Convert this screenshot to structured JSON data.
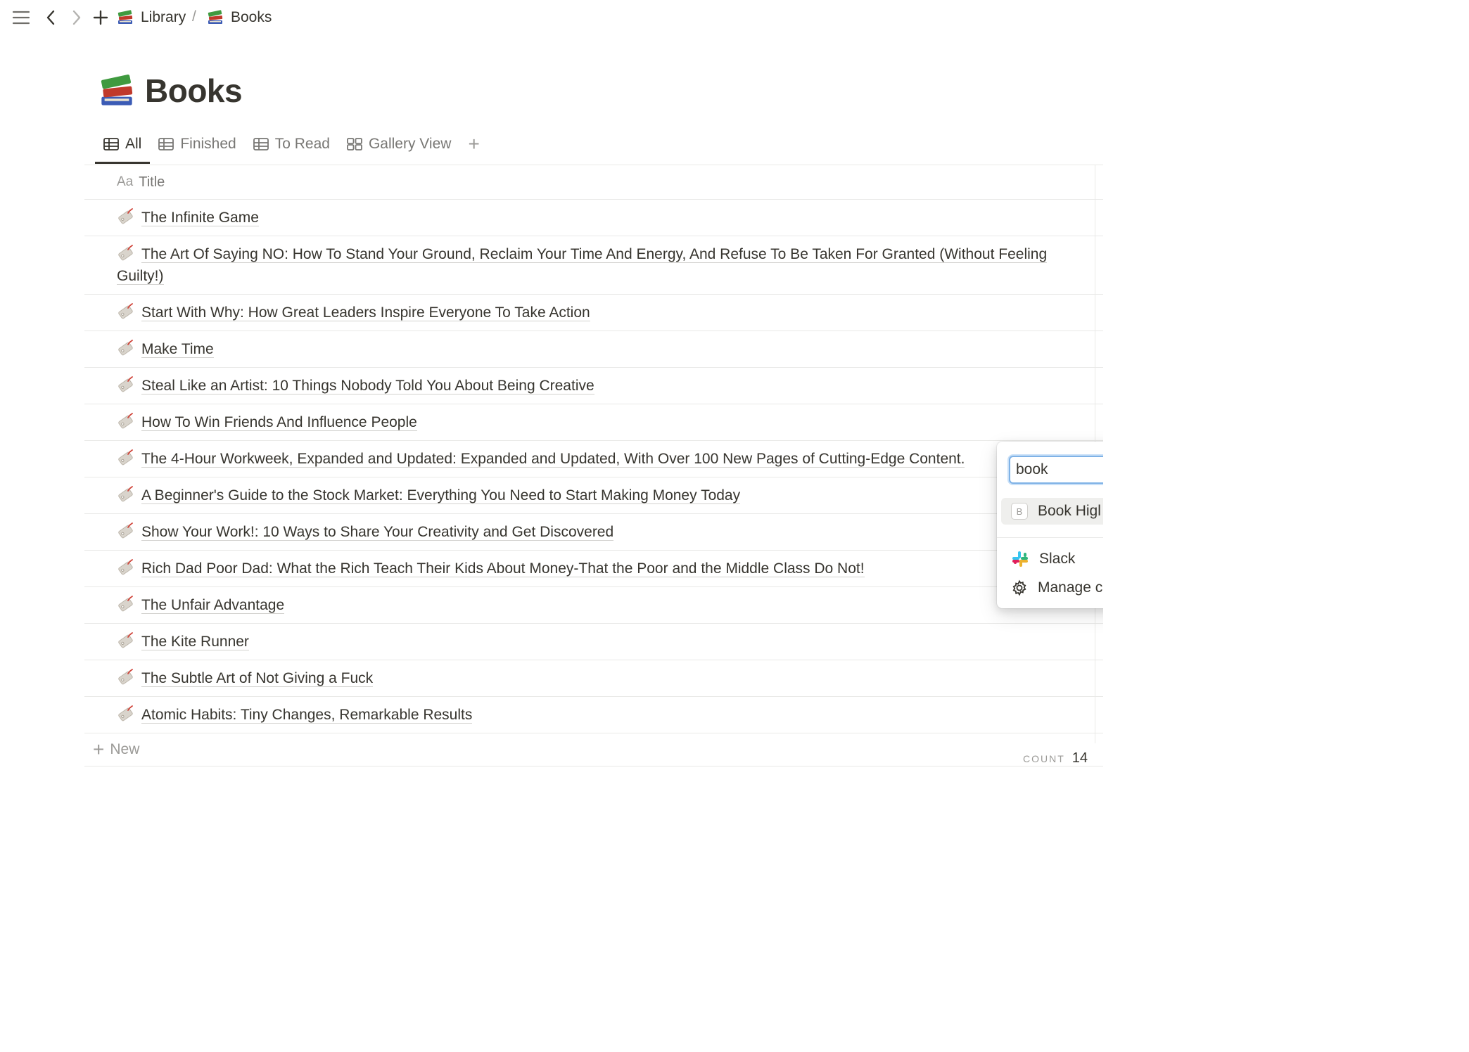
{
  "topbar": {
    "breadcrumbs": [
      {
        "label": "Library",
        "icon": "books-emoji"
      },
      {
        "label": "Books",
        "icon": "books-emoji"
      }
    ],
    "separator": "/"
  },
  "page": {
    "title": "Books",
    "icon": "books-emoji"
  },
  "tabs": [
    {
      "label": "All",
      "icon": "table-icon",
      "active": true
    },
    {
      "label": "Finished",
      "icon": "table-icon"
    },
    {
      "label": "To Read",
      "icon": "table-icon"
    },
    {
      "label": "Gallery View",
      "icon": "gallery-icon"
    }
  ],
  "table": {
    "header": {
      "icon_text": "Aa",
      "label": "Title"
    },
    "rows": [
      "The Infinite Game",
      "The Art Of Saying NO: How To Stand Your Ground, Reclaim Your Time And Energy, And Refuse To Be Taken For Granted (Without Feeling Guilty!)",
      "Start With Why: How Great Leaders Inspire Everyone To Take Action",
      "Make Time",
      "Steal Like an Artist: 10 Things Nobody Told You About Being Creative",
      "How To Win Friends And Influence People",
      "The 4-Hour Workweek, Expanded and Updated: Expanded and Updated, With Over 100 New Pages of Cutting-Edge Content.",
      "A Beginner's Guide to the Stock Market: Everything You Need to Start Making Money Today",
      "Show Your Work!: 10 Ways to Share Your Creativity and Get Discovered",
      "Rich Dad Poor Dad: What the Rich Teach Their Kids About Money-That the Poor and the Middle Class Do Not!",
      "The Unfair Advantage",
      "The Kite Runner",
      "The Subtle Art of Not Giving a Fuck",
      "Atomic Habits: Tiny Changes, Remarkable Results"
    ],
    "new_label": "New",
    "count_label": "COUNT",
    "count_value": "14"
  },
  "popup": {
    "search_value": "book",
    "results": [
      {
        "badge": "B",
        "label": "Book Higl"
      }
    ],
    "actions": [
      {
        "icon": "slack-icon",
        "label": "Slack"
      },
      {
        "icon": "gear-icon",
        "label": "Manage c"
      }
    ]
  },
  "colors": {
    "text": "#37352f",
    "muted": "#787774",
    "divider": "#e9e9e7",
    "focus": "#2383e2"
  }
}
